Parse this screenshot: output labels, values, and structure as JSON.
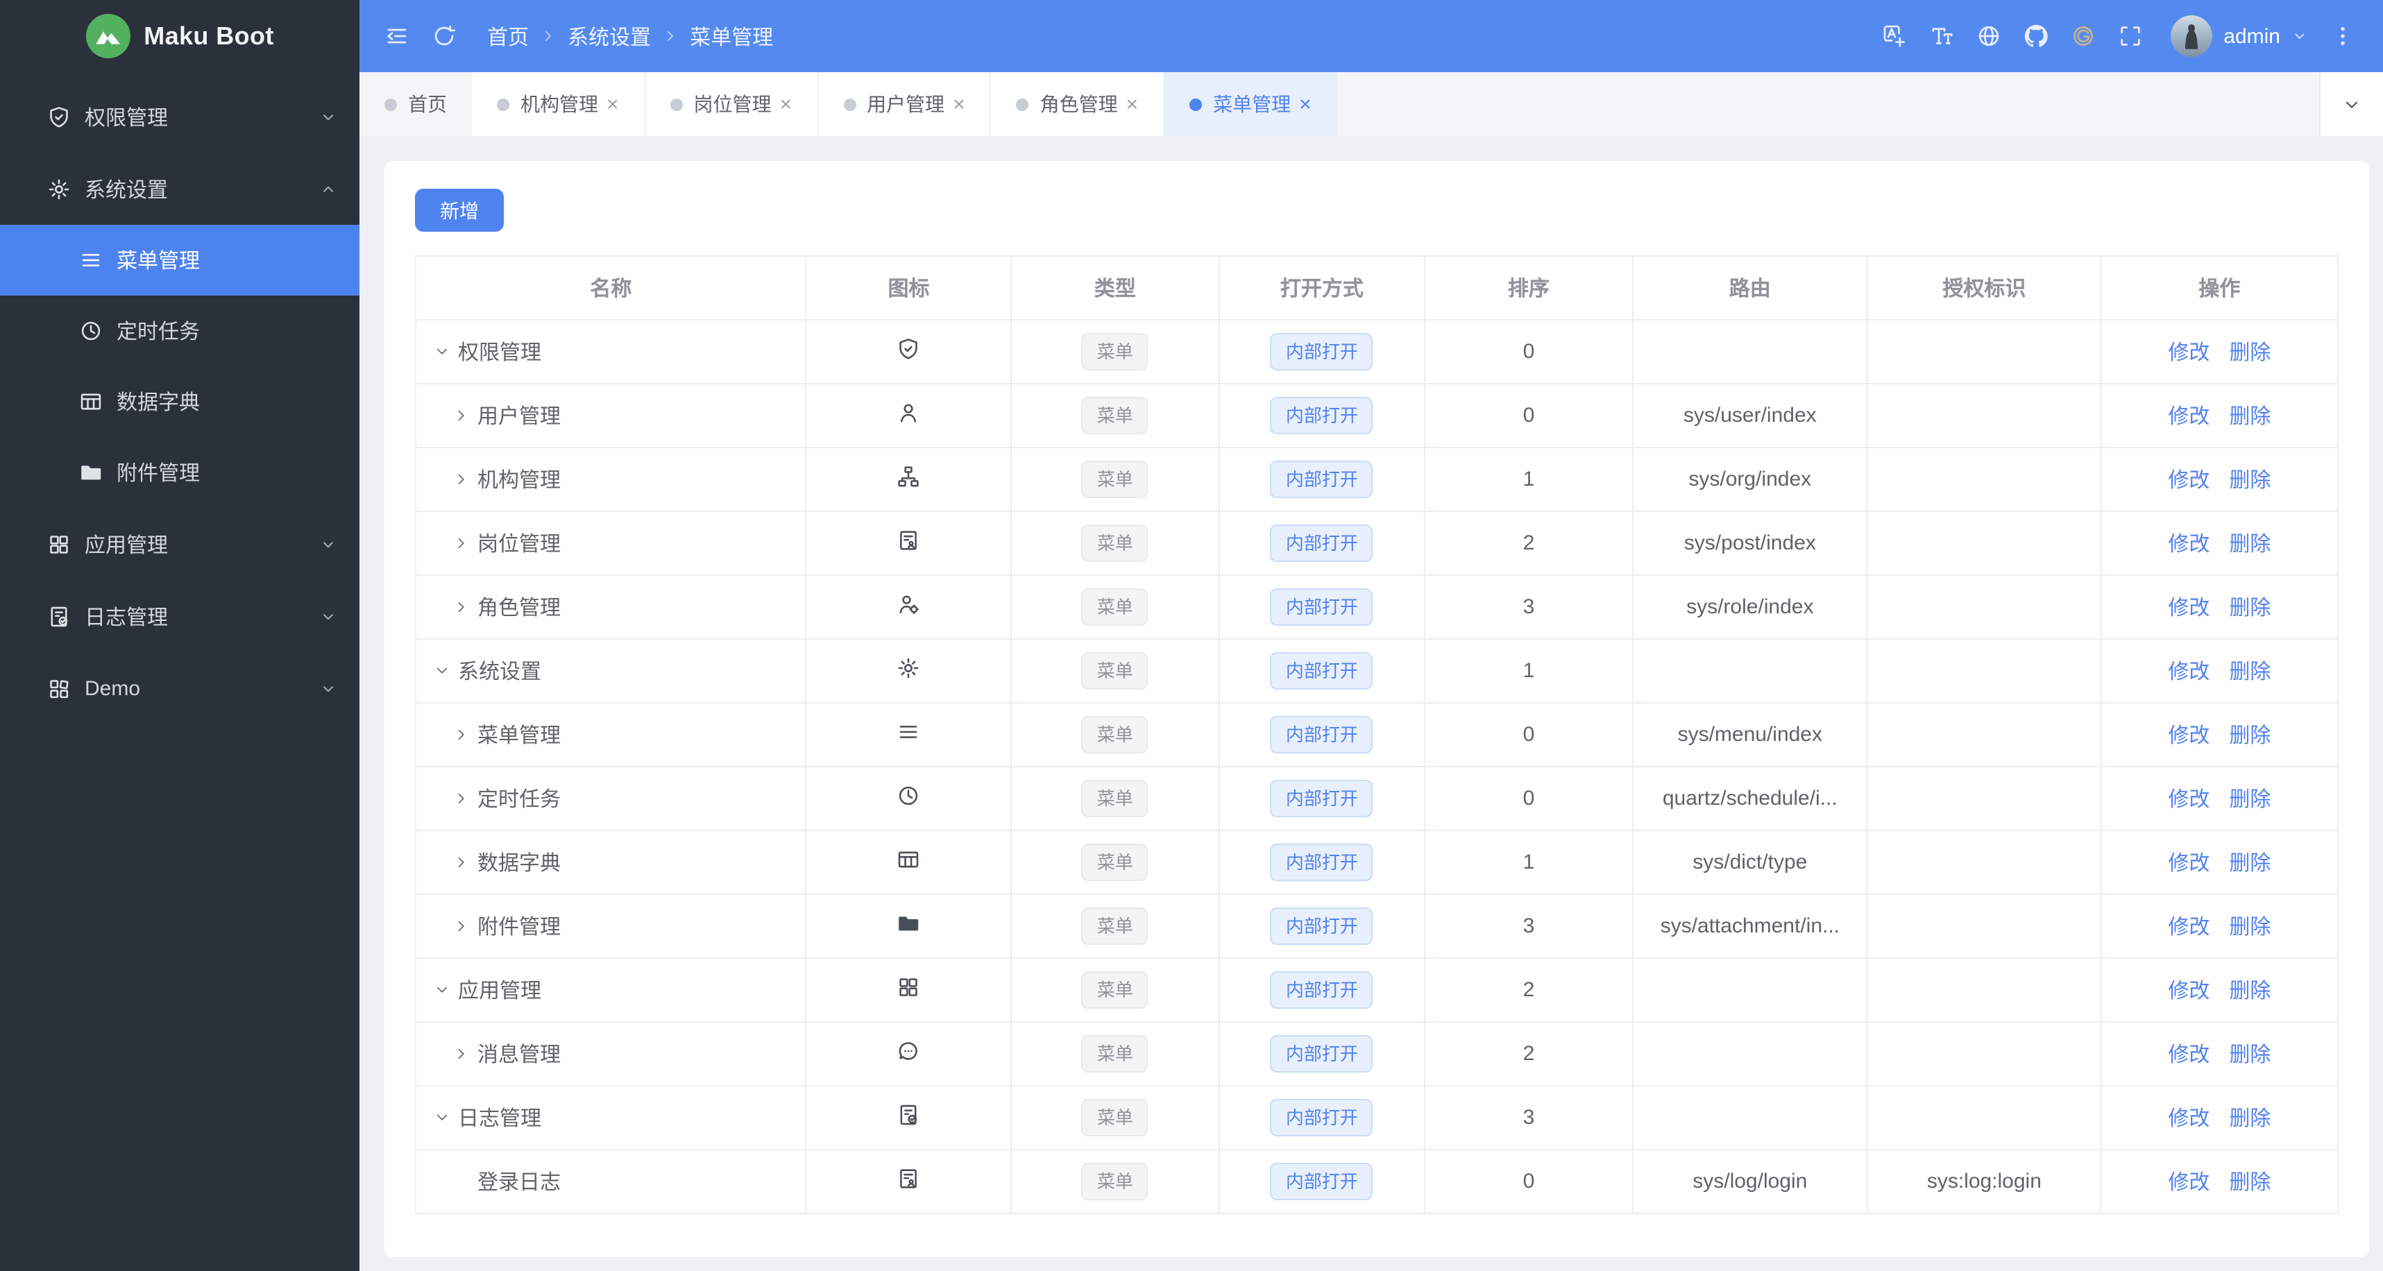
{
  "app": {
    "title": "Maku Boot"
  },
  "colors": {
    "header_blue": "#548af0",
    "sidebar_dark": "#2b313b",
    "accent_blue": "#4d83ee",
    "link_blue": "#5282ee",
    "logo_green": "#53b05f",
    "gitee_gold": "#c9b58d",
    "tag_gray_text": "#909399",
    "content_bg": "#eef0f4"
  },
  "header": {
    "breadcrumb": [
      "首页",
      "系统设置",
      "菜单管理"
    ],
    "username": "admin",
    "icons": [
      "collapse-icon",
      "refresh-icon",
      "translate-icon",
      "font-size-icon",
      "globe-icon",
      "github-icon",
      "gitee-icon",
      "fullscreen-icon",
      "kebab-menu-icon"
    ]
  },
  "sidebar": {
    "items": [
      {
        "key": "permission",
        "icon": "shield-check-icon",
        "label": "权限管理",
        "type": "group",
        "chevron": "down"
      },
      {
        "key": "system",
        "icon": "gear-icon",
        "label": "系统设置",
        "type": "group",
        "chevron": "up"
      },
      {
        "key": "menu",
        "icon": "menu-lines-icon",
        "label": "菜单管理",
        "type": "sub",
        "active": true
      },
      {
        "key": "schedule",
        "icon": "clock-icon",
        "label": "定时任务",
        "type": "sub"
      },
      {
        "key": "dict",
        "icon": "dict-table-icon",
        "label": "数据字典",
        "type": "sub"
      },
      {
        "key": "attachment",
        "icon": "folder-icon",
        "label": "附件管理",
        "type": "sub"
      },
      {
        "key": "app",
        "icon": "app-grid-icon",
        "label": "应用管理",
        "type": "group",
        "chevron": "down"
      },
      {
        "key": "log",
        "icon": "log-doc-icon",
        "label": "日志管理",
        "type": "group",
        "chevron": "down"
      },
      {
        "key": "demo",
        "icon": "demo-grid-icon",
        "label": "Demo",
        "type": "group",
        "chevron": "down"
      }
    ]
  },
  "tabs": [
    {
      "label": "首页",
      "closable": false,
      "active": false,
      "home": true
    },
    {
      "label": "机构管理",
      "closable": true,
      "active": false
    },
    {
      "label": "岗位管理",
      "closable": true,
      "active": false
    },
    {
      "label": "用户管理",
      "closable": true,
      "active": false
    },
    {
      "label": "角色管理",
      "closable": true,
      "active": false
    },
    {
      "label": "菜单管理",
      "closable": true,
      "active": true
    }
  ],
  "toolbar": {
    "add_label": "新增"
  },
  "table": {
    "columns": [
      "名称",
      "图标",
      "类型",
      "打开方式",
      "排序",
      "路由",
      "授权标识",
      "操作"
    ],
    "type_label": "菜单",
    "open_label": "内部打开",
    "edit_label": "修改",
    "delete_label": "删除",
    "rows": [
      {
        "name": "权限管理",
        "level": 1,
        "arrow": "expanded",
        "icon": "shield-check-icon",
        "sort": "0",
        "route": "",
        "auth": ""
      },
      {
        "name": "用户管理",
        "level": 2,
        "arrow": "collapsed",
        "icon": "user-icon",
        "sort": "0",
        "route": "sys/user/index",
        "auth": ""
      },
      {
        "name": "机构管理",
        "level": 2,
        "arrow": "collapsed",
        "icon": "org-tree-icon",
        "sort": "1",
        "route": "sys/org/index",
        "auth": ""
      },
      {
        "name": "岗位管理",
        "level": 2,
        "arrow": "collapsed",
        "icon": "post-card-icon",
        "sort": "2",
        "route": "sys/post/index",
        "auth": ""
      },
      {
        "name": "角色管理",
        "level": 2,
        "arrow": "collapsed",
        "icon": "role-user-icon",
        "sort": "3",
        "route": "sys/role/index",
        "auth": ""
      },
      {
        "name": "系统设置",
        "level": 1,
        "arrow": "expanded",
        "icon": "gear-icon",
        "sort": "1",
        "route": "",
        "auth": ""
      },
      {
        "name": "菜单管理",
        "level": 2,
        "arrow": "collapsed",
        "icon": "menu-lines-icon",
        "sort": "0",
        "route": "sys/menu/index",
        "auth": ""
      },
      {
        "name": "定时任务",
        "level": 2,
        "arrow": "collapsed",
        "icon": "clock-icon",
        "sort": "0",
        "route": "quartz/schedule/i...",
        "auth": ""
      },
      {
        "name": "数据字典",
        "level": 2,
        "arrow": "collapsed",
        "icon": "dict-table-icon",
        "sort": "1",
        "route": "sys/dict/type",
        "auth": ""
      },
      {
        "name": "附件管理",
        "level": 2,
        "arrow": "collapsed",
        "icon": "folder-icon",
        "sort": "3",
        "route": "sys/attachment/in...",
        "auth": ""
      },
      {
        "name": "应用管理",
        "level": 1,
        "arrow": "expanded",
        "icon": "app-grid-icon",
        "sort": "2",
        "route": "",
        "auth": ""
      },
      {
        "name": "消息管理",
        "level": 2,
        "arrow": "collapsed",
        "icon": "chat-bubble-icon",
        "sort": "2",
        "route": "",
        "auth": ""
      },
      {
        "name": "日志管理",
        "level": 1,
        "arrow": "expanded",
        "icon": "log-doc-icon",
        "sort": "3",
        "route": "",
        "auth": ""
      },
      {
        "name": "登录日志",
        "level": 2,
        "arrow": "none",
        "icon": "post-card-icon",
        "sort": "0",
        "route": "sys/log/login",
        "auth": "sys:log:login"
      }
    ]
  }
}
